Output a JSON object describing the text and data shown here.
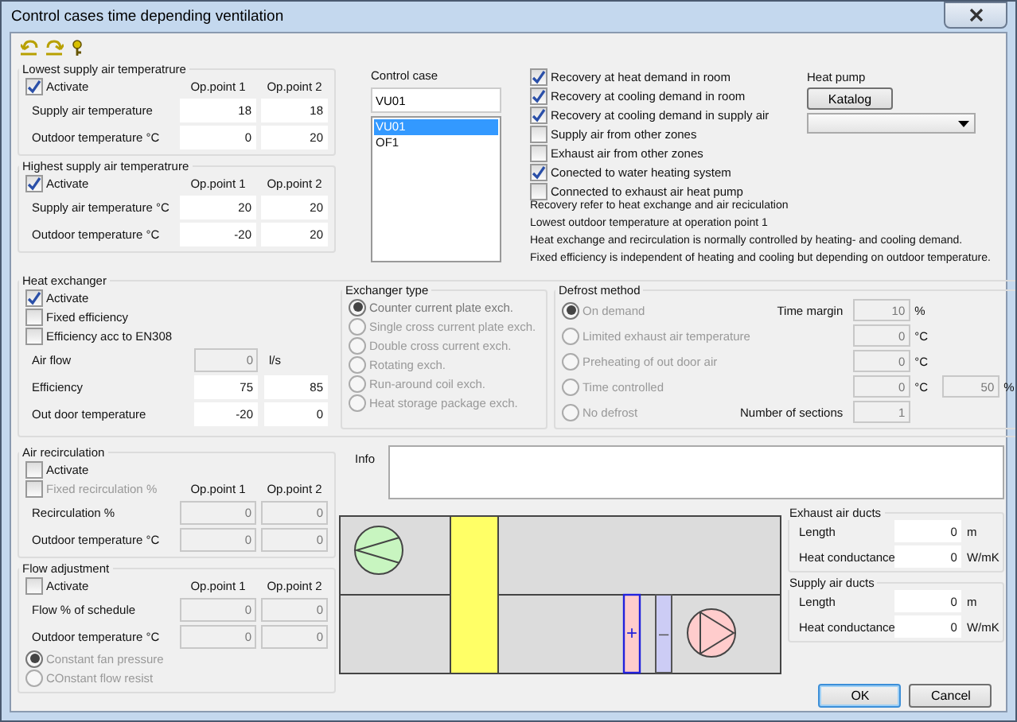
{
  "window": {
    "title": "Control cases time depending ventilation"
  },
  "lowest_supply": {
    "title": "Lowest supply air temperatrure",
    "activate": {
      "label": "Activate",
      "checked": true
    },
    "columns": [
      "Op.point 1",
      "Op.point 2"
    ],
    "rows": [
      {
        "label": "Supply air temperature",
        "values": [
          "18",
          "18"
        ],
        "disabled": false
      },
      {
        "label": "Outdoor temperature °C",
        "values": [
          "0",
          "20"
        ],
        "disabled": false
      }
    ]
  },
  "highest_supply": {
    "title": "Highest supply air temperatrure",
    "activate": {
      "label": "Activate",
      "checked": true
    },
    "columns": [
      "Op.point 1",
      "Op.point 2"
    ],
    "rows": [
      {
        "label": "Supply air temperature °C",
        "values": [
          "20",
          "20"
        ],
        "disabled": false
      },
      {
        "label": "Outdoor temperature °C",
        "values": [
          "-20",
          "20"
        ],
        "disabled": false
      }
    ]
  },
  "control_case": {
    "label": "Control case",
    "value": "VU01",
    "items": [
      {
        "label": "VU01",
        "selected": true
      },
      {
        "label": "OF1",
        "selected": false
      }
    ]
  },
  "options": [
    {
      "label": "Recovery at heat demand in room",
      "checked": true
    },
    {
      "label": "Recovery  at cooling demand in room",
      "checked": true
    },
    {
      "label": "Recovery at cooling demand in supply air",
      "checked": true
    },
    {
      "label": "Supply air from other zones",
      "checked": false
    },
    {
      "label": "Exhaust air from other zones",
      "checked": false
    },
    {
      "label": "Conected to water heating system",
      "checked": true
    },
    {
      "label": "Connected to exhaust air heat pump",
      "checked": false
    }
  ],
  "heat_pump": {
    "label": "Heat pump",
    "button": "Katalog"
  },
  "notes": [
    "Recovery refer to heat exchange and air reciculation",
    "Lowest outdoor temperature at operation point 1",
    "Heat exchange and recirculation is normally controlled by heating- and cooling demand.",
    "Fixed efficiency is independent of heating and cooling but depending on outdoor temperature."
  ],
  "heat_exchanger": {
    "title": "Heat exchanger",
    "checks": [
      {
        "label": "Activate",
        "checked": true
      },
      {
        "label": "Fixed efficiency",
        "checked": false
      },
      {
        "label": "Efficiency acc to EN308",
        "checked": false
      }
    ],
    "rows": [
      {
        "label": "Air flow",
        "values": [
          "0"
        ],
        "unit": "l/s",
        "disabled": true
      },
      {
        "label": "Efficiency",
        "values": [
          "75",
          "85"
        ],
        "disabled": false
      },
      {
        "label": "Out door temperature",
        "values": [
          "-20",
          "0"
        ],
        "disabled": false
      }
    ],
    "exchanger_type": {
      "title": "Exchanger type",
      "disabled": true,
      "options": [
        {
          "label": "Counter current plate exch.",
          "selected": true
        },
        {
          "label": "Single cross current plate exch.",
          "selected": false
        },
        {
          "label": "Double cross current exch.",
          "selected": false
        },
        {
          "label": "Rotating exch.",
          "selected": false
        },
        {
          "label": "Run-around coil exch.",
          "selected": false
        },
        {
          "label": "Heat storage package exch.",
          "selected": false
        }
      ]
    },
    "defrost": {
      "title": "Defrost method",
      "disabled": true,
      "options": [
        {
          "label": "On demand",
          "selected": true,
          "field_label": "Time margin",
          "value": "10",
          "unit": "%"
        },
        {
          "label": "Limited exhaust air temperature",
          "selected": false,
          "value": "0",
          "unit": "°C"
        },
        {
          "label": "Preheating of out door air",
          "selected": false,
          "value": "0",
          "unit": "°C"
        },
        {
          "label": "Time controlled",
          "selected": false,
          "value": "0",
          "unit": "°C",
          "extra_value": "50",
          "extra_unit": "%"
        },
        {
          "label": "No defrost",
          "selected": false,
          "field_label": "Number of sections",
          "value": "1"
        }
      ]
    }
  },
  "air_recirculation": {
    "title": "Air recirculation",
    "checks": [
      {
        "label": "Activate",
        "checked": false,
        "disabled": false
      },
      {
        "label": "Fixed recirculation %",
        "checked": false,
        "disabled": true
      }
    ],
    "columns": [
      "Op.point 1",
      "Op.point 2"
    ],
    "rows": [
      {
        "label": "Recirculation %",
        "values": [
          "0",
          "0"
        ],
        "disabled": true
      },
      {
        "label": "Outdoor temperature °C",
        "values": [
          "0",
          "0"
        ],
        "disabled": true
      }
    ]
  },
  "flow_adjustment": {
    "title": "Flow adjustment",
    "checks": [
      {
        "label": "Activate",
        "checked": false,
        "disabled": false
      }
    ],
    "columns": [
      "Op.point 1",
      "Op.point 2"
    ],
    "rows": [
      {
        "label": "Flow % of schedule",
        "values": [
          "0",
          "0"
        ],
        "disabled": true
      },
      {
        "label": "Outdoor temperature °C",
        "values": [
          "0",
          "0"
        ],
        "disabled": true
      }
    ],
    "radios": [
      {
        "label": "Constant fan pressure",
        "selected": true,
        "disabled": true
      },
      {
        "label": "COnstant flow resist",
        "selected": false,
        "disabled": true
      }
    ]
  },
  "info": {
    "label": "Info"
  },
  "diagram": {
    "heater_sign": "+",
    "cooler_sign": "–"
  },
  "exhaust_ducts": {
    "title": "Exhaust air ducts",
    "rows": [
      {
        "label": "Length",
        "value": "0",
        "unit": "m"
      },
      {
        "label": "Heat conductance",
        "value": "0",
        "unit": "W/mK"
      }
    ]
  },
  "supply_ducts": {
    "title": "Supply air ducts",
    "rows": [
      {
        "label": "Length",
        "value": "0",
        "unit": "m"
      },
      {
        "label": "Heat conductance",
        "value": "0",
        "unit": "W/mK"
      }
    ]
  },
  "buttons": [
    {
      "label": "OK",
      "kind": "default"
    },
    {
      "label": "Cancel",
      "kind": "normal"
    }
  ]
}
